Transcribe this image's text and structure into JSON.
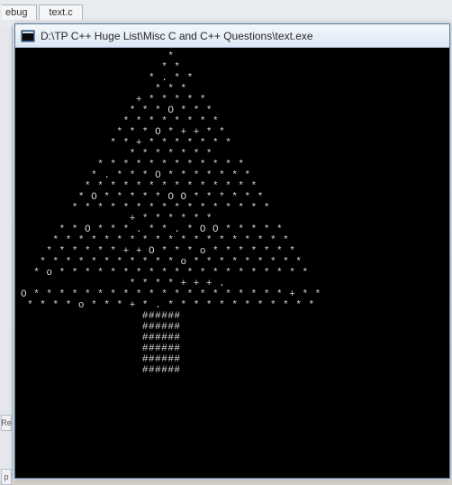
{
  "ide": {
    "tabs": [
      {
        "label": "ebug"
      },
      {
        "label": "text.c"
      }
    ],
    "sidebar_buttons": [
      {
        "label": "Re"
      },
      {
        "label": "p"
      }
    ]
  },
  "console": {
    "icon_name": "app-icon",
    "title": "D:\\TP C++ Huge List\\Misc C and C++ Questions\\text.exe",
    "lines": [
      "                       *",
      "                      * *",
      "                    * . * *",
      "                     * * *",
      "                  + * * * * *",
      "                 * * * O * * *",
      "                * * * * * * * *",
      "               * * * O * + + * *",
      "              * * + * * * * * * *",
      "                 * * * * * * *",
      "            * * * * * * * * * * * *",
      "           * . * * * O * * * * * * *",
      "          * * * * * * * * * * * * * *",
      "         * O * * * * * O O * * * * * *",
      "        * * * * * * * * * * * * * * * *",
      "                 + * * * * * *",
      "      * * O * * * . * * . * O O * * * * *",
      "     * * * * * * * * * * * * * * * * * * *",
      "    * * * * * * + + O * * * o * * * * * * *",
      "   * * * * * * * * * * * o * * * * * * * * *",
      "  * o * * * * * * * * * * * * * * * * * * * *",
      "                 * * * * + + + .",
      "O * * * * * * * * * * * * * * * * * * * * + * *",
      " * * * * o * * * + * . * * * * * * * * * * * *",
      "                   ######",
      "                   ######",
      "                   ######",
      "                   ######",
      "                   ######",
      "                   ######"
    ]
  }
}
